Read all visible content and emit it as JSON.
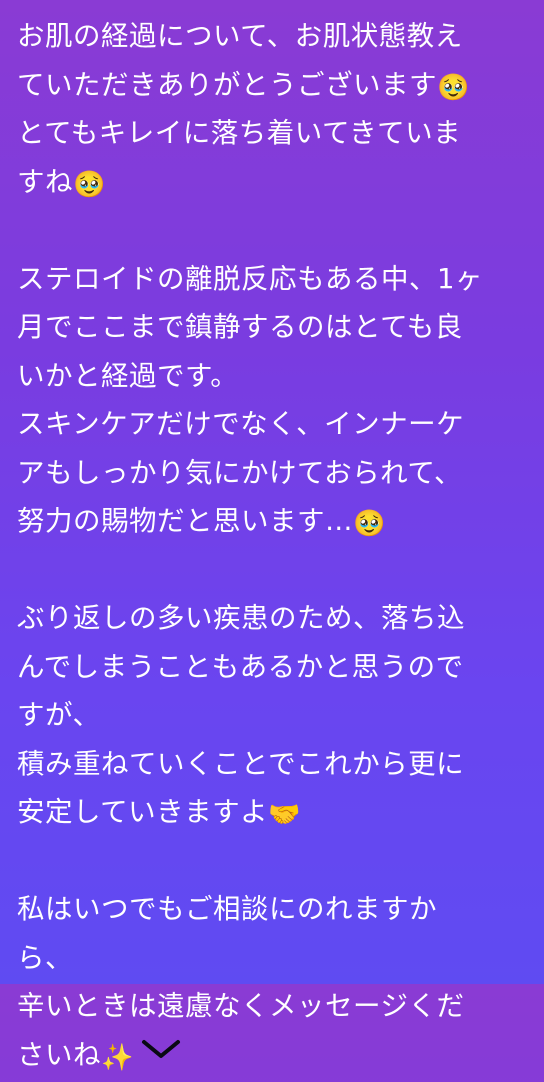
{
  "message": {
    "p1": {
      "l1": "お肌の経過について、お肌状態教え",
      "l2": "ていただきありがとうございます",
      "l2_emoji": "🥹",
      "l3": "とてもキレイに落ち着いてきていま",
      "l4": "すね",
      "l4_emoji": "🥹"
    },
    "p2": {
      "l1": "ステロイドの離脱反応もある中、1ヶ",
      "l2": "月でここまで鎮静するのはとても良",
      "l3": "いかと経過です。",
      "l4": "スキンケアだけでなく、インナーケ",
      "l5": "アもしっかり気にかけておられて、",
      "l6": "努力の賜物だと思います…",
      "l6_emoji": "🥹"
    },
    "p3": {
      "l1": "ぶり返しの多い疾患のため、落ち込",
      "l2": "んでしまうこともあるかと思うので",
      "l3": "すが、",
      "l4": "積み重ねていくことでこれから更に",
      "l5": "安定していきますよ",
      "l5_emoji": "🤝"
    },
    "p4": {
      "l1": "私はいつでもご相談にのれますか",
      "l2": "ら、",
      "l3": "辛いときは遠慮なくメッセージくだ",
      "l4": "さいね",
      "l4_emoji": "✨"
    }
  },
  "icons": {
    "expand": "chevron-down-icon"
  }
}
